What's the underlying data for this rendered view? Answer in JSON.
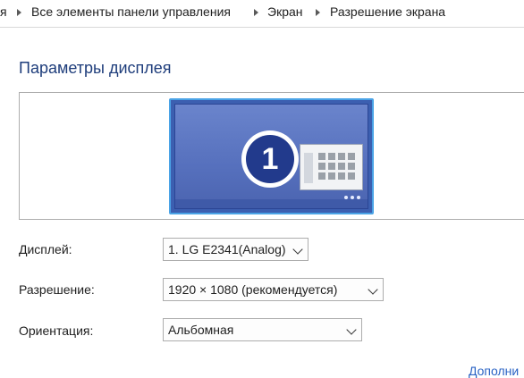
{
  "breadcrumb": {
    "items": [
      "я",
      "Все элементы панели управления",
      "Экран",
      "Разрешение экрана"
    ]
  },
  "page": {
    "title": "Параметры дисплея"
  },
  "monitor": {
    "number": "1"
  },
  "form": {
    "display": {
      "label": "Дисплей:",
      "value": "1. LG E2341(Analog)"
    },
    "resolution": {
      "label": "Разрешение:",
      "value": "1920 × 1080 (рекомендуется)"
    },
    "orientation": {
      "label": "Ориентация:",
      "value": "Альбомная"
    }
  },
  "links": {
    "more": "Дополни"
  },
  "colors": {
    "title": "#1e3d7b",
    "monitor_border": "#4aa3e6",
    "monitor_screen": "#5670bd",
    "badge": "#223a8c",
    "link": "#2a63c4"
  }
}
